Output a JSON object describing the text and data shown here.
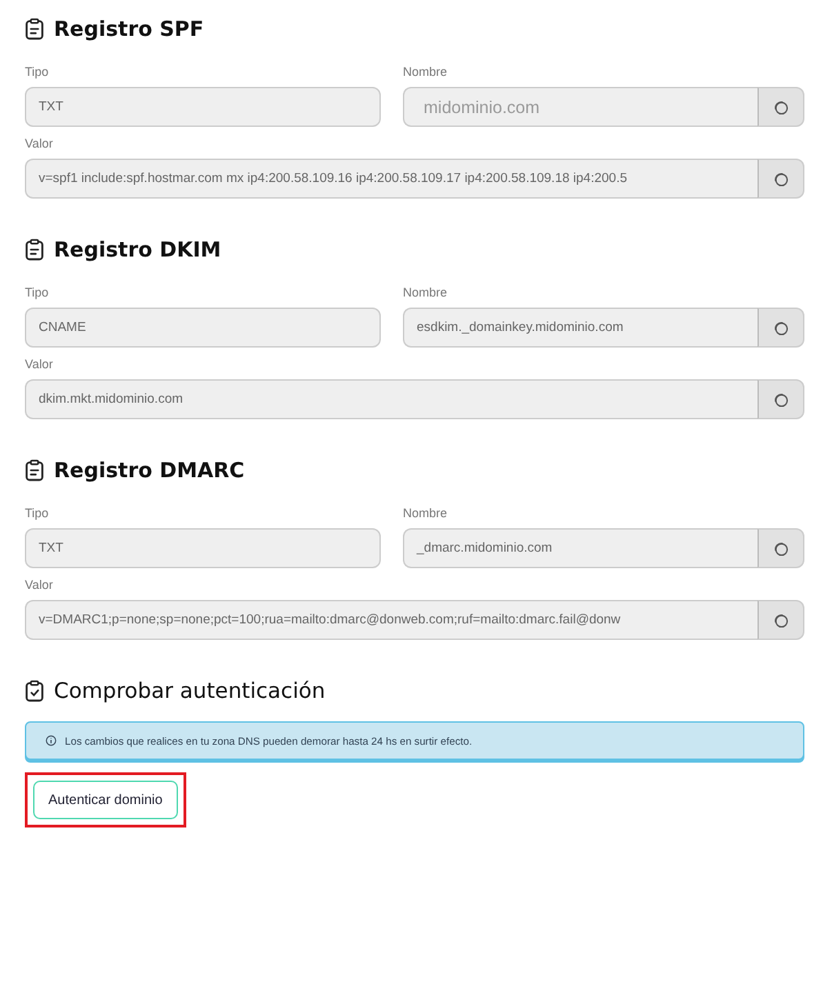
{
  "sections": [
    {
      "title": "Registro SPF",
      "tipo": {
        "label": "Tipo",
        "value": "TXT"
      },
      "nombre": {
        "label": "Nombre",
        "placeholder": "midominio.com"
      },
      "valor": {
        "label": "Valor",
        "value": "v=spf1 include:spf.hostmar.com mx ip4:200.58.109.16 ip4:200.58.109.17 ip4:200.58.109.18 ip4:200.5"
      }
    },
    {
      "title": "Registro DKIM",
      "tipo": {
        "label": "Tipo",
        "value": "CNAME"
      },
      "nombre": {
        "label": "Nombre",
        "value": "esdkim._domainkey.midominio.com"
      },
      "valor": {
        "label": "Valor",
        "value": "dkim.mkt.midominio.com"
      }
    },
    {
      "title": "Registro DMARC",
      "tipo": {
        "label": "Tipo",
        "value": "TXT"
      },
      "nombre": {
        "label": "Nombre",
        "value": "_dmarc.midominio.com"
      },
      "valor": {
        "label": "Valor",
        "value": "v=DMARC1;p=none;sp=none;pct=100;rua=mailto:dmarc@donweb.com;ruf=mailto:dmarc.fail@donw"
      }
    }
  ],
  "check": {
    "title": "Comprobar autenticación",
    "notice": "Los cambios que realices en tu zona DNS pueden demorar hasta 24 hs en surtir efecto.",
    "button": "Autenticar dominio",
    "highlighted": true
  }
}
